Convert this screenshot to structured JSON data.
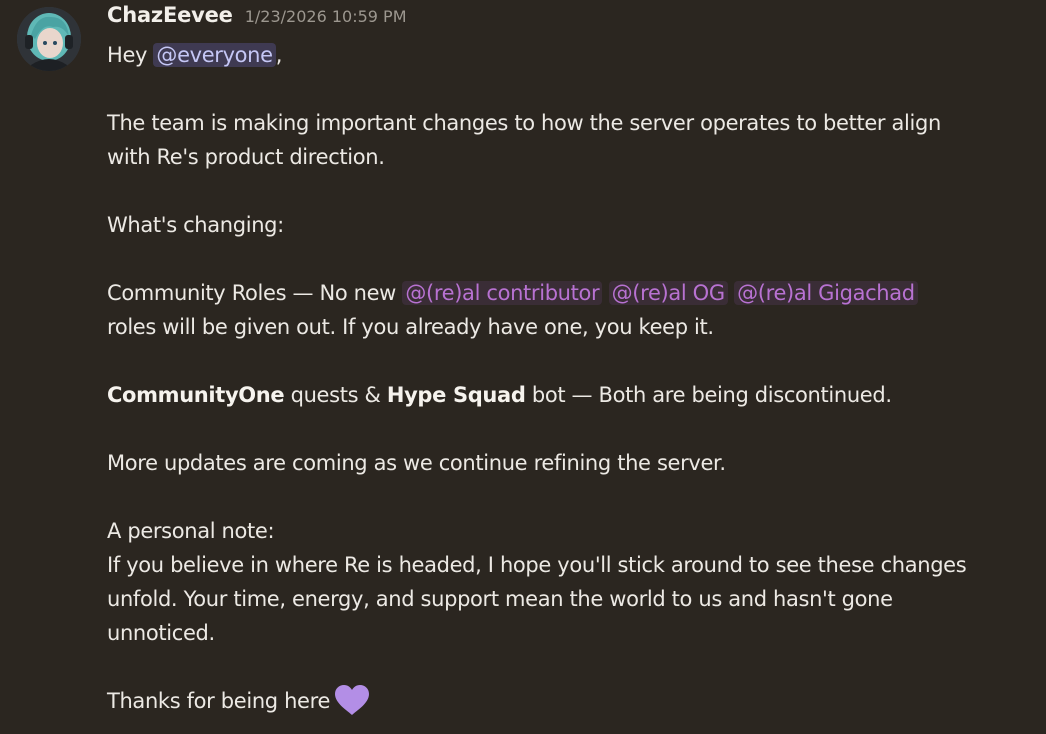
{
  "message": {
    "author": "ChazEevee",
    "timestamp": "1/23/2026 10:59 PM",
    "greeting": "Hey ",
    "mention_everyone": "@everyone",
    "greeting_comma": ",",
    "intro_line1": "The team is making important changes to how the server operates to better align",
    "intro_line2": "with Re's product direction.",
    "changing_heading": "What's changing:",
    "roles_prefix": "Community Roles — No new ",
    "role_contributor": "@(re)al contributor",
    "role_og": "@(re)al OG",
    "role_gigachad": "@(re)al Gigachad",
    "roles_line2": "roles will be given out. If you already have one, you keep it.",
    "bot_bold1": "CommunityOne",
    "bot_text1": " quests & ",
    "bot_bold2": "Hype Squad",
    "bot_text2": " bot — Both are being discontinued.",
    "updates_line": "More updates are coming as we continue refining the server.",
    "note_heading": "A personal note:",
    "note_line1": "If you believe in where Re is headed, I hope you'll stick around to see these changes",
    "note_line2": "unfold. Your time, energy, and support mean the world to us and hasn't gone",
    "note_line3": "unnoticed.",
    "thanks": "Thanks for being here",
    "emoji": "purple-heart-icon"
  },
  "colors": {
    "background": "#2b2620",
    "mention": "#c5c7f5",
    "role": "#b872d2",
    "heart": "#b38ee6"
  }
}
